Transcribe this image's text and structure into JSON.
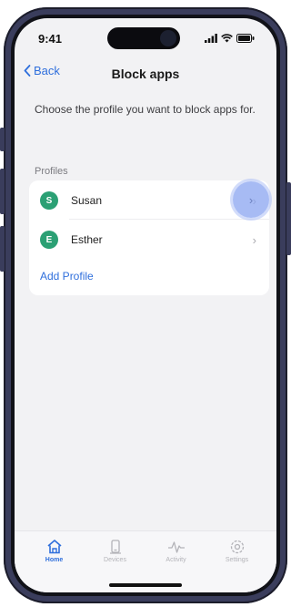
{
  "status_bar": {
    "time": "9:41"
  },
  "nav": {
    "back_label": "Back",
    "title": "Block apps"
  },
  "intro_text": "Choose the profile you want to block apps for.",
  "section_label": "Profiles",
  "profiles": [
    {
      "initial": "S",
      "name": "Susan"
    },
    {
      "initial": "E",
      "name": "Esther"
    }
  ],
  "add_profile_label": "Add Profile",
  "tabs": [
    {
      "label": "Home",
      "icon": "home-icon",
      "active": true
    },
    {
      "label": "Devices",
      "icon": "devices-icon",
      "active": false
    },
    {
      "label": "Activity",
      "icon": "activity-icon",
      "active": false
    },
    {
      "label": "Settings",
      "icon": "settings-icon",
      "active": false
    }
  ],
  "colors": {
    "accent": "#2f6fdc",
    "avatar": "#2ba074",
    "background": "#f2f2f4",
    "highlight": "#89a4f0"
  }
}
